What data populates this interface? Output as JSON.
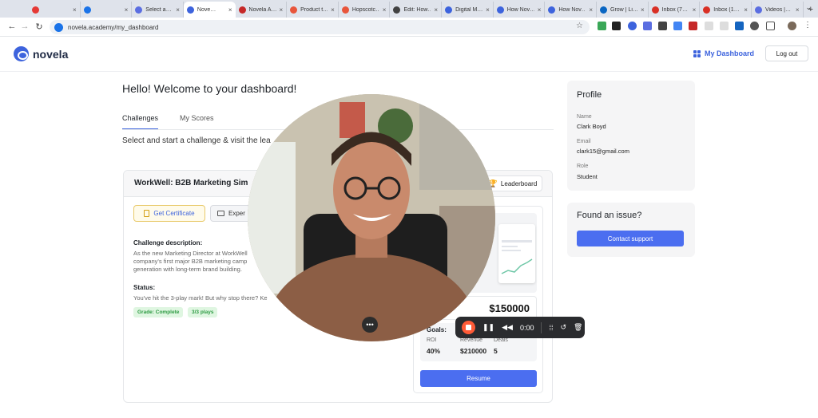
{
  "browser": {
    "tabs": [
      {
        "label": "",
        "color": "#e53935"
      },
      {
        "label": "",
        "color": "#1a73e8"
      },
      {
        "label": "Select a…",
        "color": "#5b6ee1"
      },
      {
        "label": "Nove…",
        "color": "#3d63dd",
        "active": true
      },
      {
        "label": "Novela A…",
        "color": "#c62828"
      },
      {
        "label": "Product t…",
        "color": "#e8553b"
      },
      {
        "label": "Hopscotc…",
        "color": "#e8553b"
      },
      {
        "label": "Edit: How…",
        "color": "#424242"
      },
      {
        "label": "Digital M…",
        "color": "#3d63dd"
      },
      {
        "label": "How Nov…",
        "color": "#3d63dd"
      },
      {
        "label": "How Nov…",
        "color": "#3d63dd"
      },
      {
        "label": "Grow | Li…",
        "color": "#0a66c2"
      },
      {
        "label": "Inbox (7…",
        "color": "#d93025"
      },
      {
        "label": "Inbox (1…",
        "color": "#d93025"
      },
      {
        "label": "Videos |…",
        "color": "#5b6ee1"
      }
    ],
    "new_tab": "+",
    "url": "novela.academy/my_dashboard"
  },
  "header": {
    "brand": "novela",
    "my_dashboard": "My Dashboard",
    "logout": "Log out"
  },
  "main": {
    "welcome": "Hello! Welcome to your dashboard!",
    "tabs": [
      "Challenges",
      "My Scores"
    ],
    "instruction": "Select and start a challenge & visit the lea",
    "card": {
      "title": "WorkWell: B2B Marketing Sim",
      "leaderboard": "Leaderboard",
      "get_certificate": "Get Certificate",
      "experience": "Exper",
      "desc_label": "Challenge description:",
      "desc_lines": [
        "As the new Marketing Director at WorkWell",
        "company's first major B2B marketing camp",
        "generation with long-term brand building."
      ],
      "status_label": "Status:",
      "status_text": "You've hit the 3-play mark! But why stop there? Ke",
      "badges": [
        "Grade: Complete",
        "3/3 plays"
      ],
      "price": "$150000",
      "goals_label": "Goals:",
      "goals": [
        {
          "label": "ROI",
          "value": "40%"
        },
        {
          "label": "Revenue",
          "value": "$210000"
        },
        {
          "label": "Deals",
          "value": "5"
        }
      ],
      "resume": "Resume"
    }
  },
  "profile": {
    "heading": "Profile",
    "name_label": "Name",
    "name": "Clark Boyd",
    "email_label": "Email",
    "email": "clark15@gmail.com",
    "role_label": "Role",
    "role": "Student"
  },
  "issue": {
    "heading": "Found an issue?",
    "button": "Contact support"
  },
  "recorder": {
    "time": "0:00"
  }
}
